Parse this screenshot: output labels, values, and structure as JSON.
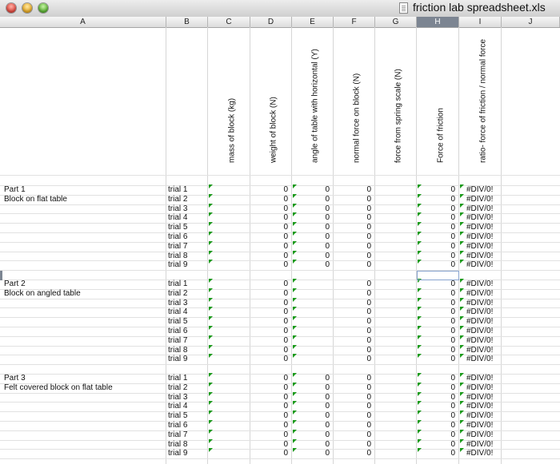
{
  "window": {
    "title": "friction lab spreadsheet.xls",
    "traffic_lights": [
      "close",
      "minimize",
      "zoom"
    ],
    "document_icon": "spreadsheet-document-icon"
  },
  "columns": [
    "A",
    "B",
    "C",
    "D",
    "E",
    "F",
    "G",
    "H",
    "I",
    "J"
  ],
  "selected_column": "H",
  "headers": {
    "C": "mass of block (kg)",
    "D": "weight of block (N)",
    "E": "angle of table with horizontal (Y)",
    "F": "normal force on block (N)",
    "G": "force from spring scale (N)",
    "H": "Force of friction",
    "I": "ratio- force of friction / normal force"
  },
  "error_text": "#DIV/0!",
  "sections": [
    {
      "label": "Part 1",
      "description": "Block on flat table",
      "trials": [
        {
          "trial": "trial 1",
          "D": "0",
          "E": "0",
          "F": "0",
          "H": "0",
          "I": "#DIV/0!"
        },
        {
          "trial": "trial 2",
          "D": "0",
          "E": "0",
          "F": "0",
          "H": "0",
          "I": "#DIV/0!"
        },
        {
          "trial": "trial 3",
          "D": "0",
          "E": "0",
          "F": "0",
          "H": "0",
          "I": "#DIV/0!"
        },
        {
          "trial": "trial 4",
          "D": "0",
          "E": "0",
          "F": "0",
          "H": "0",
          "I": "#DIV/0!"
        },
        {
          "trial": "trial 5",
          "D": "0",
          "E": "0",
          "F": "0",
          "H": "0",
          "I": "#DIV/0!"
        },
        {
          "trial": "trial 6",
          "D": "0",
          "E": "0",
          "F": "0",
          "H": "0",
          "I": "#DIV/0!"
        },
        {
          "trial": "trial 7",
          "D": "0",
          "E": "0",
          "F": "0",
          "H": "0",
          "I": "#DIV/0!"
        },
        {
          "trial": "trial 8",
          "D": "0",
          "E": "0",
          "F": "0",
          "H": "0",
          "I": "#DIV/0!"
        },
        {
          "trial": "trial 9",
          "D": "0",
          "E": "0",
          "F": "0",
          "H": "0",
          "I": "#DIV/0!"
        }
      ]
    },
    {
      "label": "Part 2",
      "description": "Block on angled table",
      "trials": [
        {
          "trial": "trial 1",
          "D": "0",
          "E": "",
          "F": "0",
          "H": "0",
          "I": "#DIV/0!"
        },
        {
          "trial": "trial 2",
          "D": "0",
          "E": "",
          "F": "0",
          "H": "0",
          "I": "#DIV/0!"
        },
        {
          "trial": "trial 3",
          "D": "0",
          "E": "",
          "F": "0",
          "H": "0",
          "I": "#DIV/0!"
        },
        {
          "trial": "trial 4",
          "D": "0",
          "E": "",
          "F": "0",
          "H": "0",
          "I": "#DIV/0!"
        },
        {
          "trial": "trial 5",
          "D": "0",
          "E": "",
          "F": "0",
          "H": "0",
          "I": "#DIV/0!"
        },
        {
          "trial": "trial 6",
          "D": "0",
          "E": "",
          "F": "0",
          "H": "0",
          "I": "#DIV/0!"
        },
        {
          "trial": "trial 7",
          "D": "0",
          "E": "",
          "F": "0",
          "H": "0",
          "I": "#DIV/0!"
        },
        {
          "trial": "trial 8",
          "D": "0",
          "E": "",
          "F": "0",
          "H": "0",
          "I": "#DIV/0!"
        },
        {
          "trial": "trial 9",
          "D": "0",
          "E": "",
          "F": "0",
          "H": "0",
          "I": "#DIV/0!"
        }
      ]
    },
    {
      "label": "Part 3",
      "description": "Felt covered block on flat table",
      "trials": [
        {
          "trial": "trial 1",
          "D": "0",
          "E": "0",
          "F": "0",
          "H": "0",
          "I": "#DIV/0!"
        },
        {
          "trial": "trial 2",
          "D": "0",
          "E": "0",
          "F": "0",
          "H": "0",
          "I": "#DIV/0!"
        },
        {
          "trial": "trial 3",
          "D": "0",
          "E": "0",
          "F": "0",
          "H": "0",
          "I": "#DIV/0!"
        },
        {
          "trial": "trial 4",
          "D": "0",
          "E": "0",
          "F": "0",
          "H": "0",
          "I": "#DIV/0!"
        },
        {
          "trial": "trial 5",
          "D": "0",
          "E": "0",
          "F": "0",
          "H": "0",
          "I": "#DIV/0!"
        },
        {
          "trial": "trial 6",
          "D": "0",
          "E": "0",
          "F": "0",
          "H": "0",
          "I": "#DIV/0!"
        },
        {
          "trial": "trial 7",
          "D": "0",
          "E": "0",
          "F": "0",
          "H": "0",
          "I": "#DIV/0!"
        },
        {
          "trial": "trial 8",
          "D": "0",
          "E": "0",
          "F": "0",
          "H": "0",
          "I": "#DIV/0!"
        },
        {
          "trial": "trial 9",
          "D": "0",
          "E": "0",
          "F": "0",
          "H": "0",
          "I": "#DIV/0!"
        }
      ]
    }
  ],
  "colors": {
    "comment_marker": "#1b9a1b",
    "selected_header": "#7c8592",
    "selection_border": "#88a4d0",
    "gridline": "#d6d6d6"
  }
}
